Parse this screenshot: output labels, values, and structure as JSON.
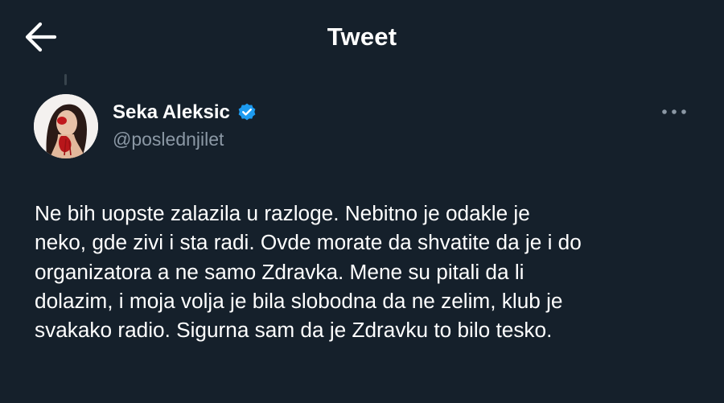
{
  "header": {
    "title": "Tweet",
    "back_icon": "arrow-left-icon"
  },
  "author": {
    "display_name": "Seka Aleksic",
    "handle": "@poslednjilet",
    "verified": true,
    "verified_color": "#1d9bf0",
    "avatar_icon": "profile-photo"
  },
  "tweet": {
    "lines": [
      "Ne bih uopste zalazila u razloge. Nebitno je odakle je",
      "neko, gde zivi i sta radi. Ovde morate da shvatite da je i do",
      "organizatora a ne samo Zdravka. Mene su pitali da li",
      "dolazim, i moja volja je bila slobodna da ne zelim, klub je",
      "svakako radio. Sigurna sam da je Zdravku to bilo tesko."
    ]
  },
  "actions": {
    "more_icon": "more-horizontal-icon"
  },
  "colors": {
    "background": "#15202b",
    "text_primary": "#ffffff",
    "text_secondary": "#8b98a5"
  }
}
